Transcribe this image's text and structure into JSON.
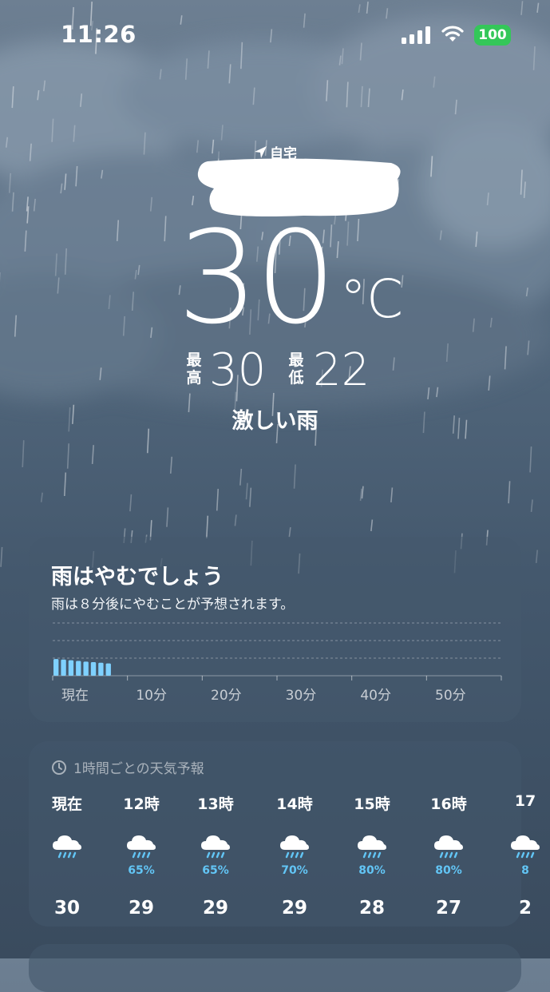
{
  "status_bar": {
    "time": "11:26",
    "battery": "100"
  },
  "location": {
    "label": "自宅"
  },
  "current": {
    "temperature": "30",
    "unit": "°C",
    "high_label": "最高",
    "high": "30",
    "low_label": "最低",
    "low": "22",
    "condition": "激しい雨"
  },
  "rain_card": {
    "title": "雨はやむでしょう",
    "subtitle": "雨は８分後にやむことが予想されます。",
    "axis_labels": [
      "現在",
      "10分",
      "20分",
      "30分",
      "40分",
      "50分"
    ],
    "chart_data": {
      "type": "bar",
      "x": [
        0,
        1,
        2,
        3,
        4,
        5,
        6,
        7,
        8,
        9,
        10,
        11,
        12,
        13,
        14,
        15,
        16,
        17,
        18,
        19,
        20,
        21,
        22,
        23,
        24,
        25,
        26,
        27,
        28,
        29,
        30,
        31,
        32,
        33,
        34,
        35,
        36,
        37,
        38,
        39,
        40,
        41,
        42,
        43,
        44,
        45,
        46,
        47,
        48,
        49,
        50,
        51,
        52,
        53,
        54,
        55,
        56,
        57,
        58,
        59
      ],
      "values": [
        0.95,
        0.92,
        0.88,
        0.84,
        0.8,
        0.77,
        0.74,
        0.7,
        0,
        0,
        0,
        0,
        0,
        0,
        0,
        0,
        0,
        0,
        0,
        0,
        0,
        0,
        0,
        0,
        0,
        0,
        0,
        0,
        0,
        0,
        0,
        0,
        0,
        0,
        0,
        0,
        0,
        0,
        0,
        0,
        0,
        0,
        0,
        0,
        0,
        0,
        0,
        0,
        0,
        0,
        0,
        0,
        0,
        0,
        0,
        0,
        0,
        0,
        0,
        0
      ],
      "ylim": [
        0,
        3
      ],
      "grid": true,
      "color": "#7fd1ff"
    }
  },
  "hourly_card": {
    "header": "1時間ごとの天気予報",
    "hours": [
      {
        "time": "現在",
        "icon": "rain-icon",
        "precip": "",
        "temp": "30"
      },
      {
        "time": "12時",
        "icon": "rain-icon",
        "precip": "65%",
        "temp": "29"
      },
      {
        "time": "13時",
        "icon": "rain-icon",
        "precip": "65%",
        "temp": "29"
      },
      {
        "time": "14時",
        "icon": "rain-icon",
        "precip": "70%",
        "temp": "29"
      },
      {
        "time": "15時",
        "icon": "rain-icon",
        "precip": "80%",
        "temp": "28"
      },
      {
        "time": "16時",
        "icon": "rain-icon",
        "precip": "80%",
        "temp": "27"
      },
      {
        "time": "17",
        "icon": "rain-icon",
        "precip": "8",
        "temp": "2"
      }
    ]
  },
  "colors": {
    "precip_text": "#62c5f5",
    "battery": "#34c759",
    "redaction": "#ffffff"
  }
}
